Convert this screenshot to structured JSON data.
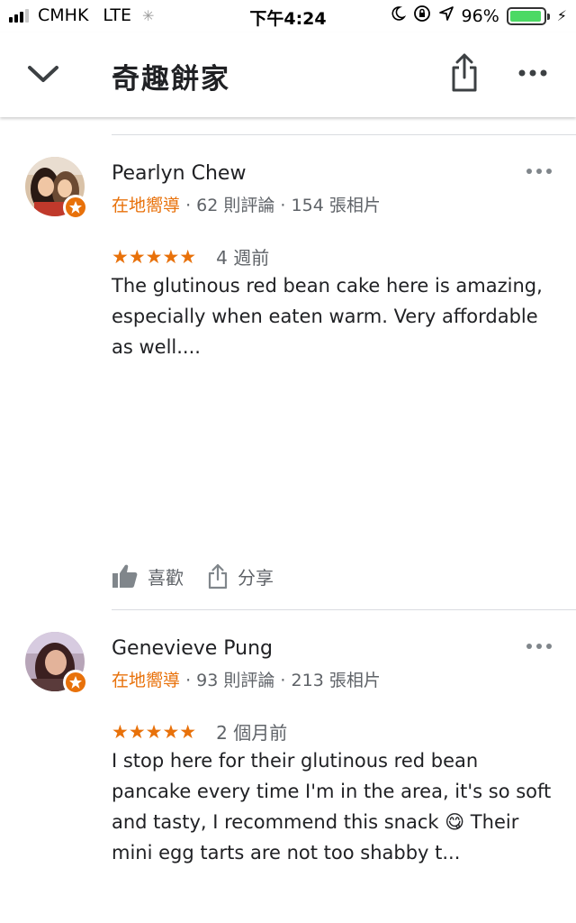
{
  "status_bar": {
    "carrier": "CMHK",
    "network": "LTE",
    "time": "下午4:24",
    "battery": "96%",
    "battery_level": 0.96
  },
  "header": {
    "title": "奇趣餅家",
    "back_icon": "chevron-down-icon",
    "share_icon": "share-icon",
    "more_icon": "more-horiz-icon"
  },
  "reviews": [
    {
      "name": "Pearlyn Chew",
      "badge": "在地嚮導",
      "reviews_count": "62 則評論",
      "photos_count": "154 張相片",
      "stars": "★★★★★",
      "rating": 5,
      "date": "4 週前",
      "text": "The glutinous red bean cake here is amazing, especially when eaten warm. Very affordable as well....",
      "like_label": "喜歡",
      "share_label": "分享"
    },
    {
      "name": "Genevieve Pung",
      "badge": "在地嚮導",
      "reviews_count": "93 則評論",
      "photos_count": "213 張相片",
      "stars": "★★★★★",
      "rating": 5,
      "date": "2 個月前",
      "text": "I stop here for their glutinous red bean pancake every time I'm in the area, it's so soft and tasty, I recommend this snack 😋 Their mini egg tarts are not too shabby t..."
    }
  ],
  "colors": {
    "accent": "#e8710a",
    "text": "#202124",
    "secondary": "#5f6368",
    "battery": "#4cd964"
  }
}
